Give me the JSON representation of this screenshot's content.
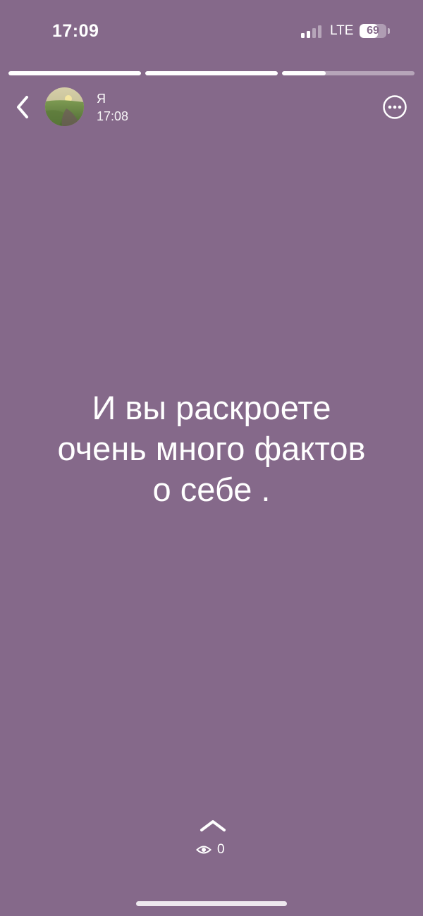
{
  "status_bar": {
    "time": "17:09",
    "network": "LTE",
    "battery_level": "69",
    "signal_bars": 2
  },
  "progress": {
    "segments": [
      1.0,
      1.0,
      0.33
    ]
  },
  "header": {
    "author_name": "Я",
    "post_time": "17:08",
    "back_icon": "chevron-left-icon",
    "more_icon": "ellipsis-circle-icon"
  },
  "story": {
    "line_1": "И вы раскроете",
    "line_2": "очень много фактов",
    "line_3": "о себе .",
    "background_color": "#85698a"
  },
  "footer": {
    "swipe_icon": "chevron-up-icon",
    "views_icon": "eye-icon",
    "views_count": "0"
  }
}
